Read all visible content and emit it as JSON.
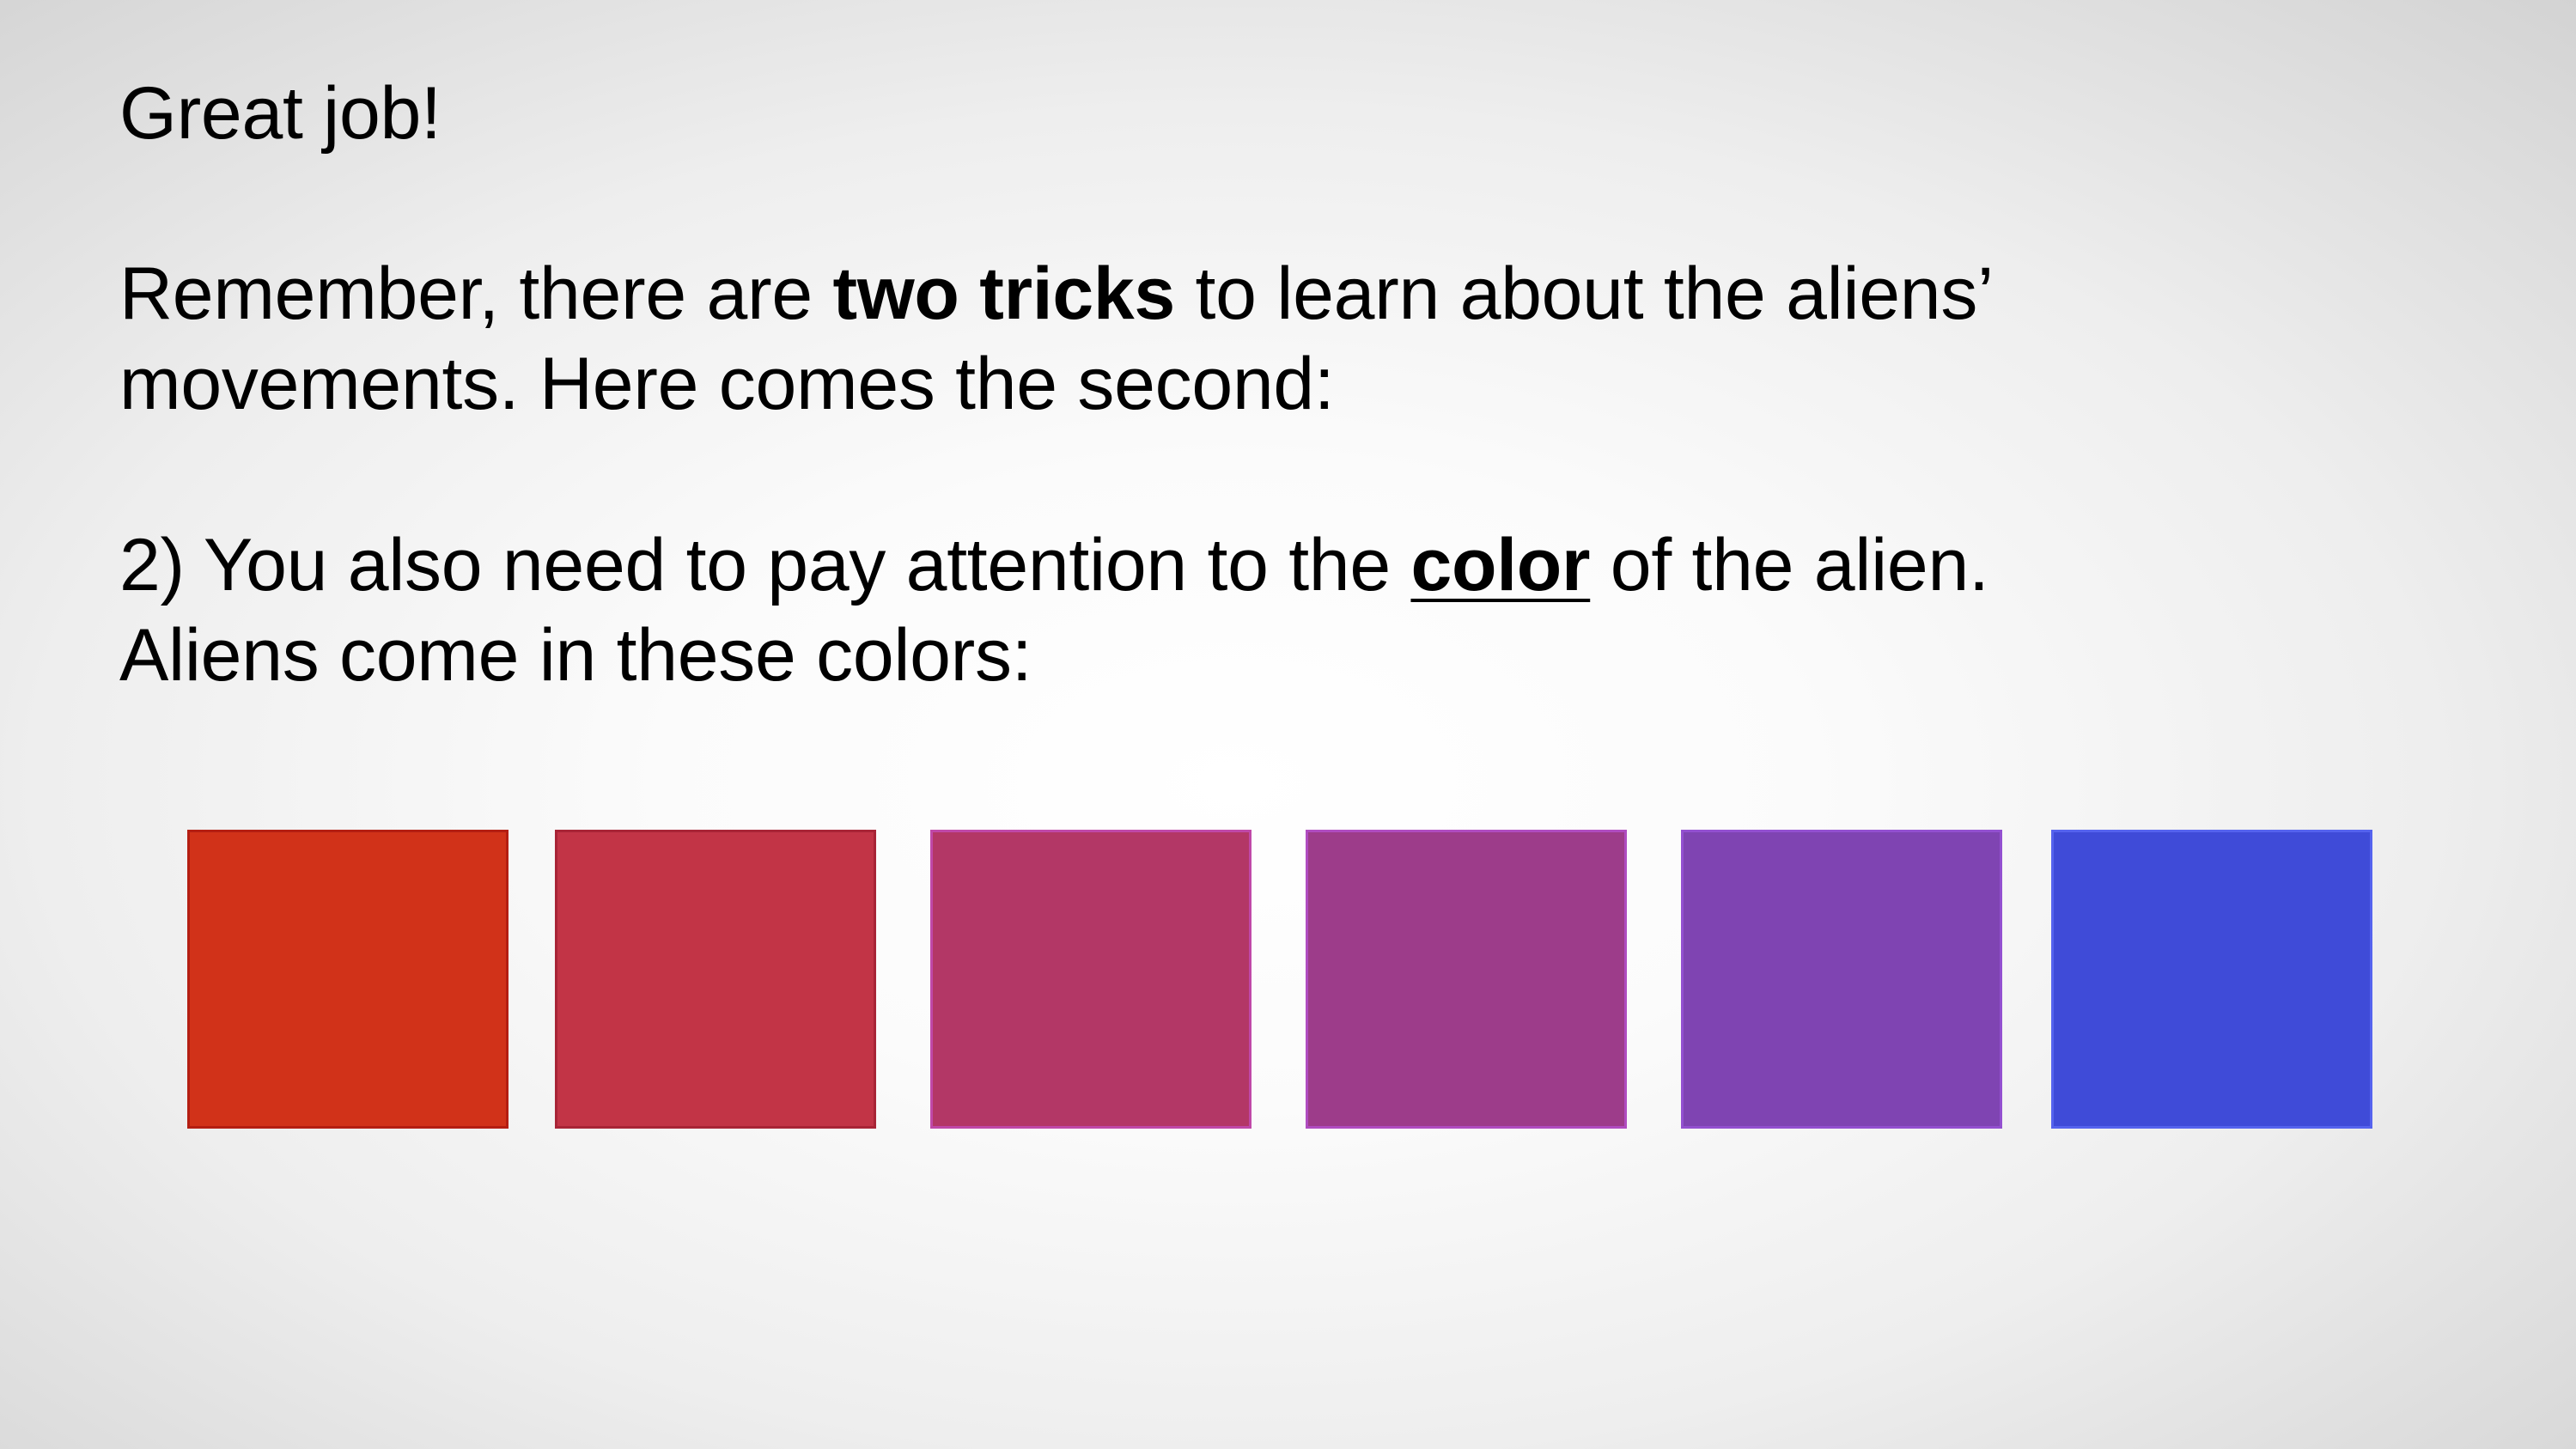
{
  "slide": {
    "greeting": "Great job!",
    "reminder": {
      "line1_before": "Remember, there are ",
      "line1_bold": "two tricks",
      "line1_after": " to learn about the aliens’",
      "line2": "movements. Here comes the second:"
    },
    "color_tip": {
      "line1_before": "2) You also need to pay attention to the ",
      "line1_emphasis": "color",
      "line1_after": " of the alien.",
      "line2": "Aliens come in these colors:"
    }
  },
  "swatches": [
    {
      "fill": "#d13219",
      "border": "#b41e12"
    },
    {
      "fill": "#c23446",
      "border": "#a82436"
    },
    {
      "fill": "#b33766",
      "border": "#c048a8"
    },
    {
      "fill": "#9d3c8a",
      "border": "#b04cc0"
    },
    {
      "fill": "#7f44b2",
      "border": "#9350d0"
    },
    {
      "fill": "#3f4bd8",
      "border": "#5563ee"
    }
  ]
}
